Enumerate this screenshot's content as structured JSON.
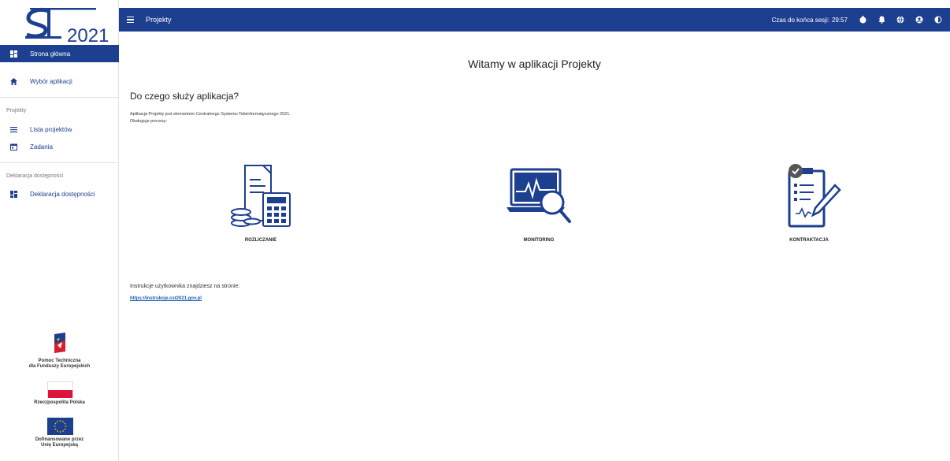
{
  "logo": {
    "text": "2021"
  },
  "sidebar": {
    "items": [
      {
        "label": "Strona główna",
        "icon": "dashboard-icon"
      },
      {
        "label": "Wybór aplikacji",
        "icon": "home-icon"
      },
      {
        "label": "Lista projektów",
        "icon": "list-icon"
      },
      {
        "label": "Zadania",
        "icon": "calendar-icon"
      },
      {
        "label": "Deklaracja dostępności",
        "icon": "dashboard-icon"
      }
    ],
    "sections": [
      "Projekty",
      "Deklaracja dostępności"
    ],
    "partners": [
      {
        "line1": "Pomoc Techniczna",
        "line2": "dla Funduszy Europejskich"
      },
      {
        "line1": "Rzeczpospolita Polska",
        "line2": ""
      },
      {
        "line1": "Dofinansowane przez",
        "line2": "Unię Europejską"
      }
    ]
  },
  "topbar": {
    "title": "Projekty",
    "session_label": "Czas do końca sesji:",
    "session_time": "29:57",
    "accent": "#1d3f8f"
  },
  "main": {
    "welcome": "Witamy w aplikacji Projekty",
    "heading": "Do czego służy aplikacja?",
    "desc_line1": "Aplikacja Projekty jest elementem Centralnego Systemu Teleinformatycznego 2021.",
    "desc_line2": "Obsługuje procesy:",
    "features": [
      {
        "label": "ROZLICZANIE",
        "icon": "accounting-icon"
      },
      {
        "label": "MONITORING",
        "icon": "monitoring-icon"
      },
      {
        "label": "KONTRAKTACJA",
        "icon": "contract-icon"
      }
    ],
    "instructions": "Instrukcje użytkownika znajdziesz na stronie:",
    "link": "https://instrukcje.cst2021.gov.pl"
  }
}
